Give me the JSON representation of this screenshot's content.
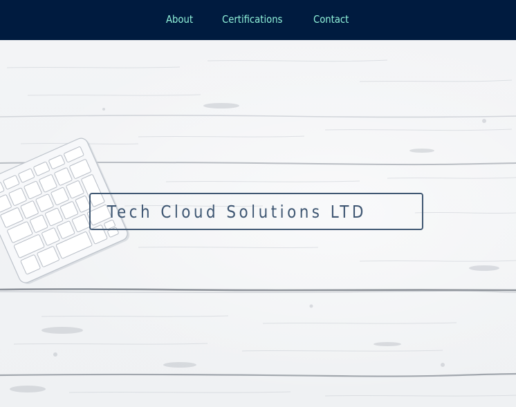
{
  "nav": {
    "about": "About",
    "certifications": "Certifications",
    "contact": "Contact"
  },
  "hero": {
    "title": "Tech Cloud Solutions LTD",
    "background_image": "white-wood-planks-with-keyboard"
  },
  "colors": {
    "navbar_background": "#001b3f",
    "nav_link": "#8ff1d9",
    "title_text": "#3e5672",
    "title_border": "#3f5772"
  }
}
